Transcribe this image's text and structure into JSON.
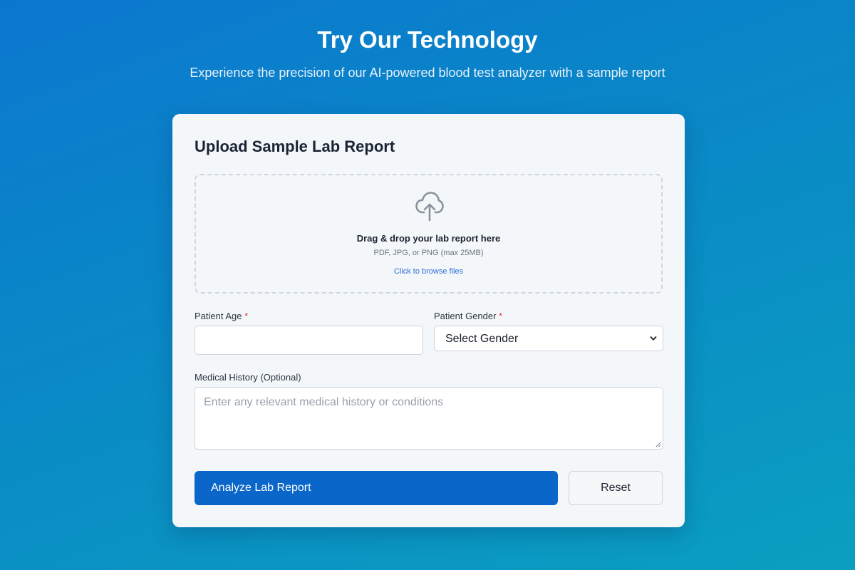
{
  "hero": {
    "title": "Try Our Technology",
    "subtitle": "Experience the precision of our AI-powered blood test analyzer with a sample report"
  },
  "card": {
    "title": "Upload Sample Lab Report",
    "dropzone": {
      "icon": "cloud-upload-icon",
      "title": "Drag & drop your lab report here",
      "hint": "PDF, JPG, or PNG (max 25MB)",
      "browse": "Click to browse files"
    },
    "fields": {
      "age_label": "Patient Age",
      "age_value": "",
      "gender_label": "Patient Gender",
      "gender_selected": "Select Gender",
      "required_marker": "*",
      "history_label": "Medical History (Optional)",
      "history_placeholder": "Enter any relevant medical history or conditions"
    },
    "buttons": {
      "analyze": "Analyze Lab Report",
      "reset": "Reset"
    }
  },
  "colors": {
    "background_start": "#0b78cf",
    "background_end": "#0a9fc0",
    "primary_button": "#0a66c9",
    "link": "#2f6fd6",
    "required": "#e2363a"
  }
}
